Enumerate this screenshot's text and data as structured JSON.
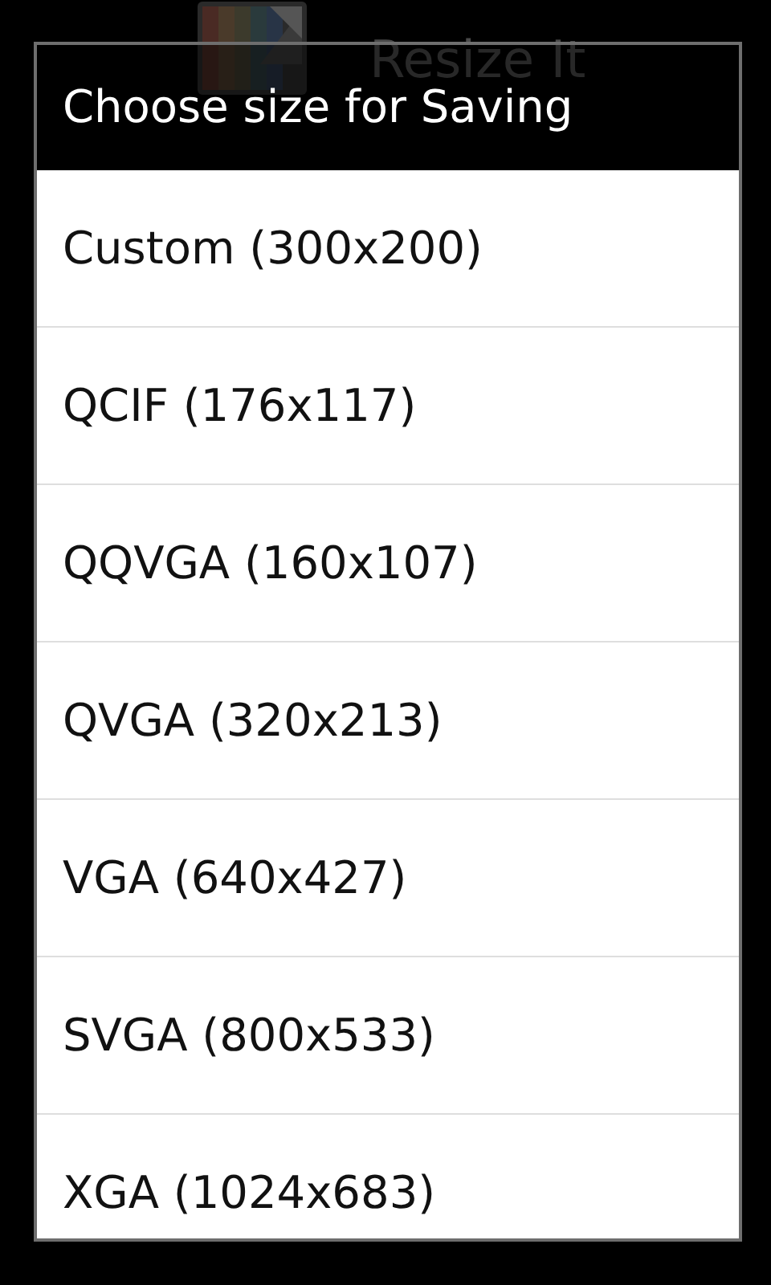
{
  "app_bar": {
    "title": "Resize It"
  },
  "dialog": {
    "title": "Choose size for Saving",
    "options": [
      {
        "label": "Custom (300x200)"
      },
      {
        "label": "QCIF (176x117)"
      },
      {
        "label": "QQVGA (160x107)"
      },
      {
        "label": "QVGA (320x213)"
      },
      {
        "label": "VGA (640x427)"
      },
      {
        "label": "SVGA (800x533)"
      },
      {
        "label": "XGA (1024x683)"
      }
    ]
  }
}
